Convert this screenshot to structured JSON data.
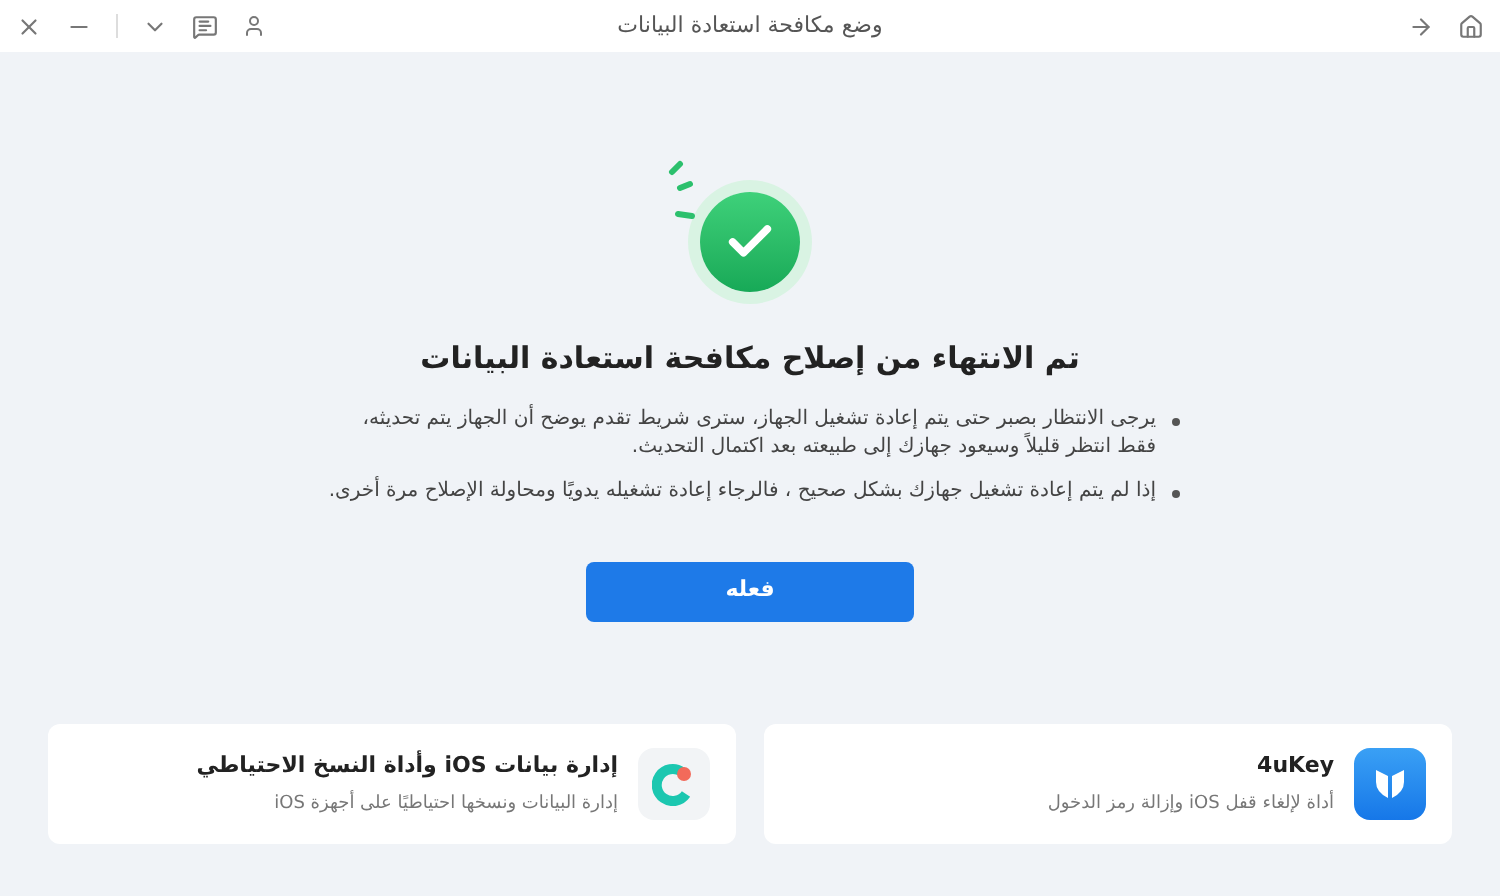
{
  "window": {
    "title": "وضع مكافحة استعادة البيانات"
  },
  "status": {
    "title": "تم الانتهاء من إصلاح مكافحة استعادة البيانات",
    "notes": [
      "يرجى الانتظار بصبر حتى يتم إعادة تشغيل الجهاز، سترى شريط تقدم يوضح أن الجهاز يتم تحديثه، فقط انتظر قليلاً وسيعود جهازك إلى طبيعته بعد اكتمال التحديث.",
      "إذا لم يتم إعادة تشغيل جهازك بشكل صحيح ، فالرجاء إعادة تشغيله يدويًا ومحاولة الإصلاح مرة أخرى."
    ]
  },
  "primary_button": "فعله",
  "products": [
    {
      "kind": "key",
      "name": "4uKey",
      "description": "أداة لإلغاء قفل iOS وإزالة رمز الدخول"
    },
    {
      "kind": "backup",
      "name": "إدارة بيانات iOS وأداة النسخ الاحتياطي",
      "description": "إدارة البيانات ونسخها احتياطيًا على أجهزة iOS"
    }
  ]
}
